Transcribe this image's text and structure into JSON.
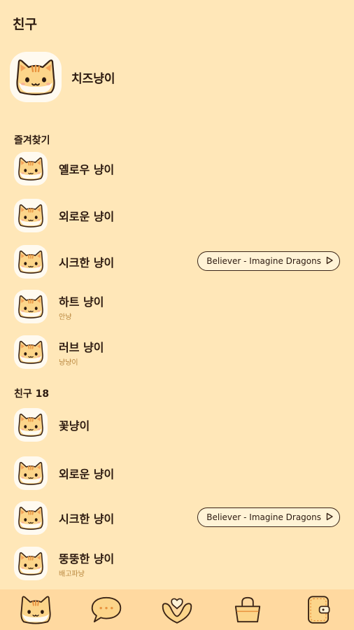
{
  "header": {
    "title": "친구"
  },
  "my_profile": {
    "name": "치즈냥이",
    "avatar_icon": "cat-face-icon"
  },
  "favorites": {
    "label": "즐겨찾기",
    "items": [
      {
        "name": "옐로우 냥이",
        "status": "",
        "music": ""
      },
      {
        "name": "외로운 냥이",
        "status": "",
        "music": ""
      },
      {
        "name": "시크한 냥이",
        "status": "",
        "music": "Believer - Imagine Dragons"
      },
      {
        "name": "하트 냥이",
        "status": "안냥",
        "music": ""
      },
      {
        "name": "러브 냥이",
        "status": "냥냥이",
        "music": ""
      }
    ]
  },
  "friends": {
    "label": "친구 18",
    "items": [
      {
        "name": "꽃냥이",
        "status": "",
        "music": ""
      },
      {
        "name": "외로운 냥이",
        "status": "",
        "music": ""
      },
      {
        "name": "시크한 냥이",
        "status": "",
        "music": "Believer - Imagine Dragons"
      },
      {
        "name": "뚱뚱한 냥이",
        "status": "배고파냥",
        "music": ""
      }
    ]
  },
  "bottom_nav": {
    "items": [
      "friends-cat-icon",
      "chat-bubble-icon",
      "heart-view-icon",
      "shopping-bag-icon",
      "wallet-icon"
    ]
  },
  "colors": {
    "background": "#ffe7b8",
    "nav": "#ffd9a0",
    "status_text": "#b9873f",
    "text": "#2c1a10"
  }
}
